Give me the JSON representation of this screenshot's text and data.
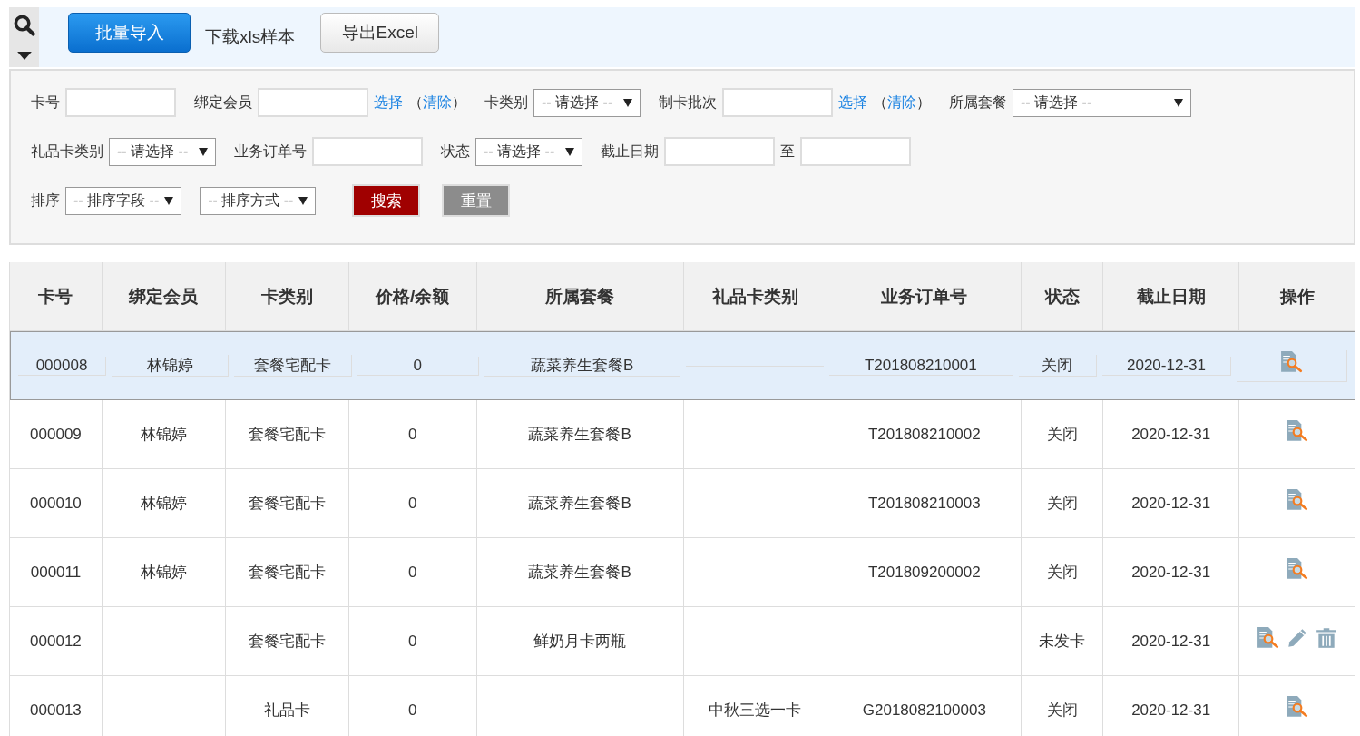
{
  "toolbar": {
    "import_button": "批量导入",
    "download_link": "下载xls样本",
    "export_button": "导出Excel"
  },
  "filters": {
    "rows": [
      [
        {
          "kind": "field",
          "label": "卡号"
        },
        {
          "kind": "field",
          "label": "绑定会员",
          "links": {
            "pick": "选择",
            "open": "（",
            "clear": "清除",
            "close": "）"
          }
        },
        {
          "kind": "select",
          "label": "卡类别",
          "value": "-- 请选择 --"
        },
        {
          "kind": "field",
          "label": "制卡批次",
          "links": {
            "pick": "选择",
            "open": "（",
            "clear": "清除",
            "close": "）"
          }
        },
        {
          "kind": "select",
          "label": "所属套餐",
          "value": "-- 请选择 --"
        }
      ],
      [
        {
          "kind": "select",
          "label": "礼品卡类别",
          "value": "-- 请选择 --"
        },
        {
          "kind": "field",
          "label": "业务订单号"
        },
        {
          "kind": "select",
          "label": "状态",
          "value": "-- 请选择 --"
        },
        {
          "kind": "range",
          "label": "截止日期",
          "separator": "至"
        }
      ],
      [
        {
          "kind": "select",
          "label": "排序",
          "value": "-- 排序字段 --"
        },
        {
          "kind": "select",
          "value": "-- 排序方式 --"
        },
        {
          "kind": "search",
          "text": "搜索"
        },
        {
          "kind": "reset",
          "text": "重置"
        }
      ]
    ]
  },
  "table": {
    "columns": [
      "卡号",
      "绑定会员",
      "卡类别",
      "价格/余额",
      "所属套餐",
      "礼品卡类别",
      "业务订单号",
      "状态",
      "截止日期",
      "操作"
    ],
    "rows": [
      {
        "selected": true,
        "cells": [
          "000008",
          "林锦婷",
          "套餐宅配卡",
          "0",
          "蔬菜养生套餐B",
          "",
          "T201808210001",
          "关闭",
          "2020-12-31"
        ],
        "actions": [
          {
            "kind": "view"
          }
        ]
      },
      {
        "selected": false,
        "cells": [
          "000009",
          "林锦婷",
          "套餐宅配卡",
          "0",
          "蔬菜养生套餐B",
          "",
          "T201808210002",
          "关闭",
          "2020-12-31"
        ],
        "actions": [
          {
            "kind": "view"
          }
        ]
      },
      {
        "selected": false,
        "cells": [
          "000010",
          "林锦婷",
          "套餐宅配卡",
          "0",
          "蔬菜养生套餐B",
          "",
          "T201808210003",
          "关闭",
          "2020-12-31"
        ],
        "actions": [
          {
            "kind": "view"
          }
        ]
      },
      {
        "selected": false,
        "cells": [
          "000011",
          "林锦婷",
          "套餐宅配卡",
          "0",
          "蔬菜养生套餐B",
          "",
          "T201809200002",
          "关闭",
          "2020-12-31"
        ],
        "actions": [
          {
            "kind": "view"
          }
        ]
      },
      {
        "selected": false,
        "cells": [
          "000012",
          "",
          "套餐宅配卡",
          "0",
          "鲜奶月卡两瓶",
          "",
          "",
          "未发卡",
          "2020-12-31"
        ],
        "actions": [
          {
            "kind": "view"
          },
          {
            "kind": "edit"
          },
          {
            "kind": "delete"
          }
        ]
      },
      {
        "selected": false,
        "cells": [
          "000013",
          "",
          "礼品卡",
          "0",
          "",
          "中秋三选一卡",
          "G2018082100003",
          "关闭",
          "2020-12-31"
        ],
        "actions": [
          {
            "kind": "view"
          }
        ]
      }
    ]
  }
}
